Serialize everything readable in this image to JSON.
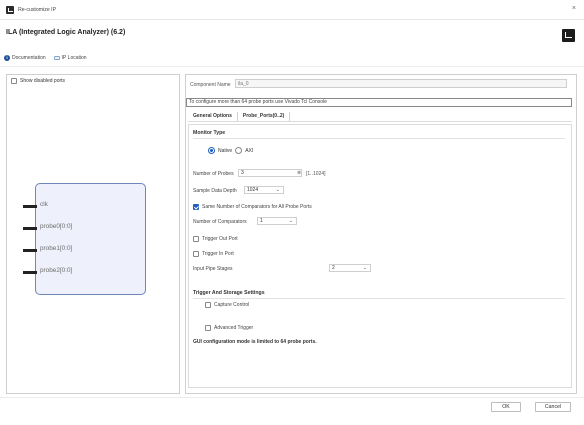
{
  "window": {
    "title": "Re-customize IP",
    "close_glyph": "×",
    "icon": "vivado-app-icon"
  },
  "header": {
    "title": "ILA (Integrated Logic Analyzer) (6.2)",
    "logo_icon": "xilinx-logo"
  },
  "toolbar": {
    "documentation_label": "Documentation",
    "ip_location_label": "IP Location"
  },
  "left_panel": {
    "show_disabled_ports_label": "Show disabled ports",
    "show_disabled_ports_checked": false,
    "ports": [
      "clk",
      "probe0[0:0]",
      "probe1[0:0]",
      "probe2[0:0]"
    ]
  },
  "config": {
    "component_name_label": "Component Name",
    "component_name_value": "ila_0",
    "note": "To configure more than 64 probe ports use Vivado Tcl Console",
    "tabs": [
      "General Options",
      "Probe_Ports(0..2)"
    ],
    "active_tab": "General Options",
    "monitor_type": {
      "heading": "Monitor Type",
      "options": [
        "Native",
        "AXI"
      ],
      "selected": "Native"
    },
    "number_of_probes": {
      "label": "Number of Probes",
      "value": "3",
      "range": "[1..1024]"
    },
    "sample_data_depth": {
      "label": "Sample Data Depth",
      "value": "1024"
    },
    "same_comparators": {
      "label": "Same Number of Comparators for All Probe Ports",
      "checked": true
    },
    "number_of_comparators": {
      "label": "Number of Comparators",
      "value": "1"
    },
    "trigger_out_port": {
      "label": "Trigger Out Port",
      "checked": false
    },
    "trigger_in_port": {
      "label": "Trigger In Port",
      "checked": false
    },
    "input_pipe_stages": {
      "label": "Input Pipe Stages",
      "value": "2"
    },
    "trigger_storage": {
      "heading": "Trigger And Storage Settings",
      "capture_control": {
        "label": "Capture Control",
        "checked": false
      },
      "advanced_trigger": {
        "label": "Advanced Trigger",
        "checked": false
      }
    },
    "gui_note": "GUI configuration mode is limited to 64 probe ports."
  },
  "buttons": {
    "ok": "OK",
    "cancel": "Cancel"
  },
  "colors": {
    "accent": "#1f5fbf",
    "ila_block_fill": "#eef0fb",
    "ila_block_border": "#6f86b8"
  }
}
